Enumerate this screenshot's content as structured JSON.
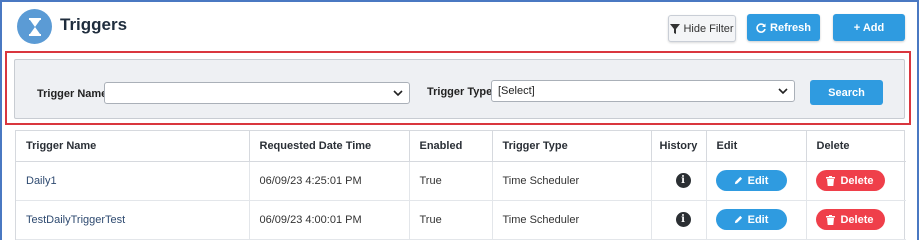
{
  "header": {
    "title": "Triggers",
    "hide_filter_label": "Hide Filter",
    "refresh_label": "Refresh",
    "add_label": "+ Add"
  },
  "filter": {
    "trigger_name_label": "Trigger Name :",
    "trigger_name_value": "",
    "trigger_type_label": "Trigger Type:",
    "trigger_type_value": "[Select]",
    "search_label": "Search"
  },
  "table": {
    "columns": [
      "Trigger Name",
      "Requested Date Time",
      "Enabled",
      "Trigger Type",
      "History",
      "Edit",
      "Delete"
    ],
    "rows": [
      {
        "name": "Daily1",
        "requested": "06/09/23 4:25:01 PM",
        "enabled": "True",
        "type": "Time Scheduler",
        "edit": "Edit",
        "delete": "Delete"
      },
      {
        "name": "TestDailyTriggerTest",
        "requested": "06/09/23 4:00:01 PM",
        "enabled": "True",
        "type": "Time Scheduler",
        "edit": "Edit",
        "delete": "Delete"
      }
    ]
  },
  "colors": {
    "accent": "#2f9be0",
    "danger": "#ef3f4a",
    "highlight_border": "#d9363e",
    "frame_border": "#4a78c2"
  },
  "icons": [
    "hourglass-icon",
    "filter-icon",
    "refresh-icon",
    "info-icon",
    "pencil-icon",
    "trash-icon",
    "chevron-down-icon"
  ]
}
